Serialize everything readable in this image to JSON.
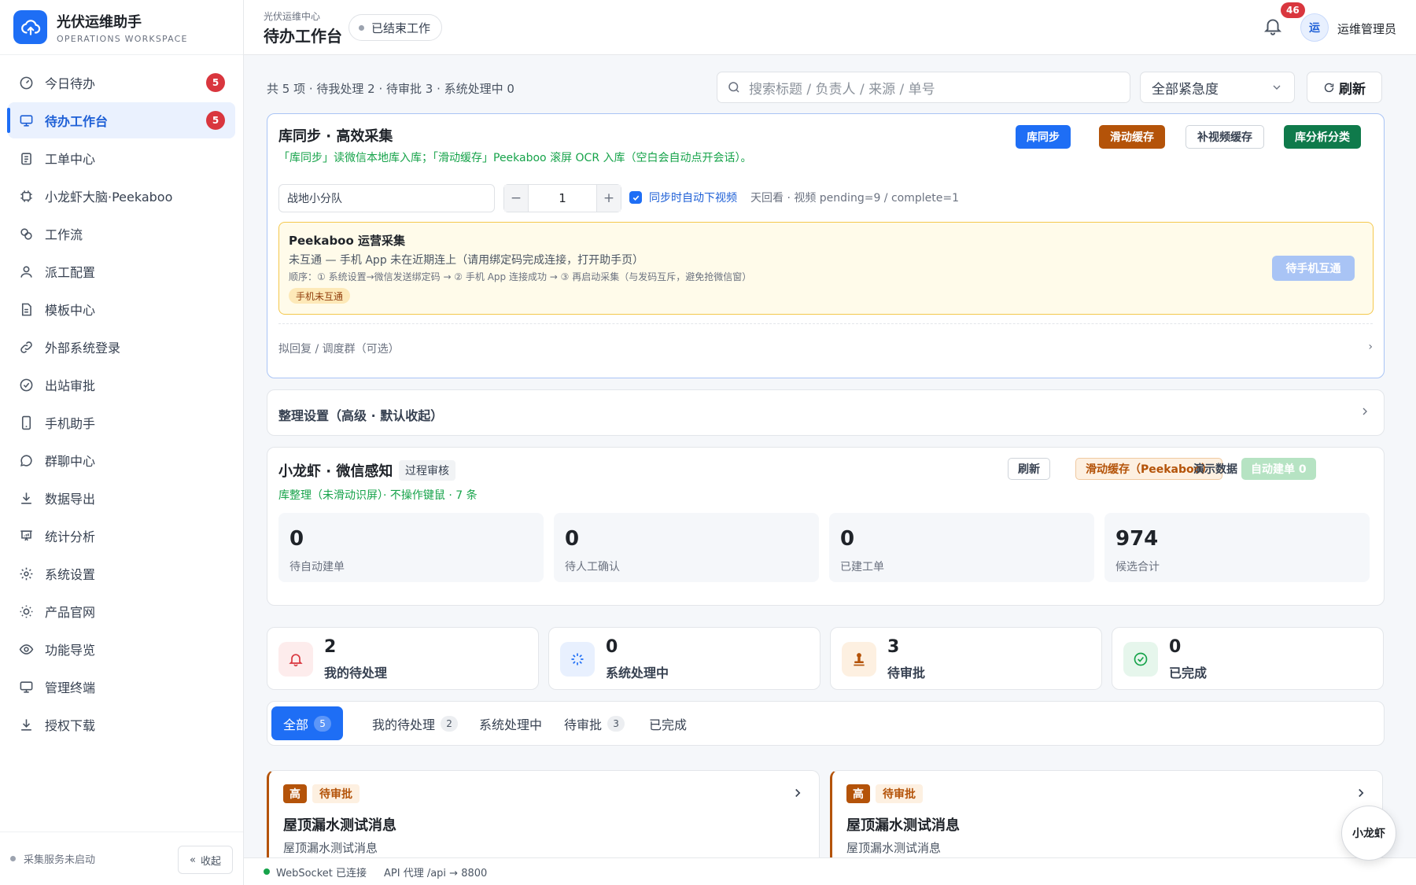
{
  "brand": {
    "name": "光伏运维助手",
    "sub": "OPERATIONS WORKSPACE"
  },
  "nav": [
    {
      "label": "今日待办",
      "badge": "5"
    },
    {
      "label": "待办工作台",
      "badge": "5",
      "active": true
    },
    {
      "label": "工单中心"
    },
    {
      "label": "小龙虾大脑·Peekaboo"
    },
    {
      "label": "工作流"
    },
    {
      "label": "派工配置"
    },
    {
      "label": "模板中心"
    },
    {
      "label": "外部系统登录"
    },
    {
      "label": "出站审批"
    },
    {
      "label": "手机助手"
    },
    {
      "label": "群聊中心"
    },
    {
      "label": "数据导出"
    },
    {
      "label": "统计分析"
    },
    {
      "label": "系统设置"
    },
    {
      "label": "产品官网"
    },
    {
      "label": "功能导览"
    },
    {
      "label": "管理终端"
    },
    {
      "label": "授权下载"
    }
  ],
  "sidebar_footer": {
    "status": "采集服务未启动",
    "collapse": "收起"
  },
  "header": {
    "crumb": "光伏运维中心",
    "title": "待办工作台",
    "pill": "已结束工作",
    "notifications": "46",
    "avatar": "运",
    "username": "运维管理员"
  },
  "toolbar": {
    "summary": "共 5 项 · 待我处理 2 · 待审批 3 · 系统处理中 0",
    "search_placeholder": "搜索标题 / 负责人 / 来源 / 单号",
    "urgency": "全部紧急度",
    "refresh": "刷新"
  },
  "sync": {
    "title": "库同步 · 高效采集",
    "desc": "「库同步」读微信本地库入库；「滑动缓存」Peekaboo 滚屏 OCR 入库（空白会自动点开会话）。",
    "buttons": [
      "库同步",
      "滑动缓存",
      "补视频缓存",
      "库分析分类"
    ],
    "team": "战地小分队",
    "count": "1",
    "auto_video": "同步时自动下视频",
    "video_status": "天回看 · 视频 pending=9 / complete=1",
    "peekaboo": {
      "title": "Peekaboo 运营采集",
      "line": "未互通 — 手机 App 未在近期连上（请用绑定码完成连接，打开助手页）",
      "order": "顺序：① 系统设置→微信发送绑定码 → ② 手机 App 连接成功 → ③ 再启动采集（与发码互斥，避免抢微信窗）",
      "tag": "手机未互通",
      "button": "待手机互通"
    },
    "reply": "拟回复 / 调度群（可选）"
  },
  "organize": {
    "label": "整理设置（高级 · 默认收起）"
  },
  "wechat": {
    "title": "小龙虾 · 微信感知",
    "tag": "过程审核",
    "sub": "库整理（未滑动识屏）· 不操作键鼠 · 7 条",
    "refresh": "刷新",
    "scroll_cache": "滑动缓存（Peekaboo）",
    "auto_create": "自动建单 0",
    "demo": "演示数据",
    "stats": [
      {
        "num": "0",
        "label": "待自动建单"
      },
      {
        "num": "0",
        "label": "待人工确认"
      },
      {
        "num": "0",
        "label": "已建工单"
      },
      {
        "num": "974",
        "label": "候选合计"
      }
    ]
  },
  "kpis": [
    {
      "num": "2",
      "label": "我的待处理"
    },
    {
      "num": "0",
      "label": "系统处理中"
    },
    {
      "num": "3",
      "label": "待审批"
    },
    {
      "num": "0",
      "label": "已完成"
    }
  ],
  "tabs": [
    {
      "label": "全部",
      "count": "5"
    },
    {
      "label": "我的待处理",
      "count": "2"
    },
    {
      "label": "系统处理中"
    },
    {
      "label": "待审批",
      "count": "3"
    },
    {
      "label": "已完成"
    }
  ],
  "tasks": [
    {
      "level": "高",
      "status": "待审批",
      "title": "屋顶漏水测试消息",
      "sub": "屋顶漏水测试消息"
    },
    {
      "level": "高",
      "status": "待审批",
      "title": "屋顶漏水测试消息",
      "sub": "屋顶漏水测试消息"
    }
  ],
  "status_bar": {
    "ws": "WebSocket 已连接",
    "api": "API 代理 /api → 8800"
  },
  "float_button": "小龙虾"
}
